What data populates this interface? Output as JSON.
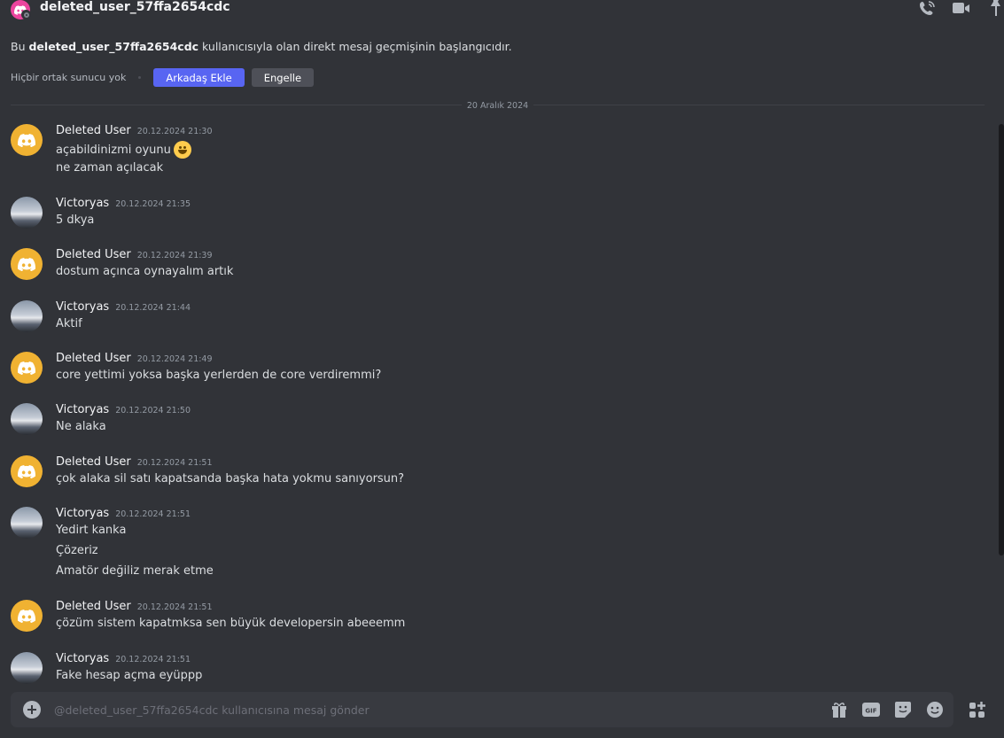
{
  "header": {
    "title": "deleted_user_57ffa2654cdc",
    "icons": [
      "phone-call-icon",
      "video-icon",
      "pin-icon"
    ]
  },
  "intro": {
    "prefix": "Bu ",
    "username": "deleted_user_57ffa2654cdc",
    "suffix": " kullanıcısıyla olan direkt mesaj geçmişinin başlangıcıdır.",
    "mutual_servers": "Hiçbir ortak sunucu yok",
    "add_friend_label": "Arkadaş Ekle",
    "block_label": "Engelle"
  },
  "date_divider": "20 Aralık 2024",
  "messages": [
    {
      "user": "Deleted User",
      "time": "20.12.2024 21:30",
      "avatar": "discord-logo-icon",
      "lines": [
        "açabildinizmi oyunu",
        "ne zaman açılacak"
      ],
      "emoji": "grinning-face-emoji"
    },
    {
      "user": "Victoryas",
      "time": "20.12.2024 21:35",
      "avatar": "user-photo",
      "lines": [
        "5 dkya"
      ]
    },
    {
      "user": "Deleted User",
      "time": "20.12.2024 21:39",
      "avatar": "discord-logo-icon",
      "lines": [
        "dostum açınca oynayalım artık"
      ]
    },
    {
      "user": "Victoryas",
      "time": "20.12.2024 21:44",
      "avatar": "user-photo",
      "lines": [
        "Aktif"
      ]
    },
    {
      "user": "Deleted User",
      "time": "20.12.2024 21:49",
      "avatar": "discord-logo-icon",
      "lines": [
        "core yettimi yoksa başka yerlerden de core verdiremmi?"
      ]
    },
    {
      "user": "Victoryas",
      "time": "20.12.2024 21:50",
      "avatar": "user-photo",
      "lines": [
        "Ne alaka"
      ]
    },
    {
      "user": "Deleted User",
      "time": "20.12.2024 21:51",
      "avatar": "discord-logo-icon",
      "lines": [
        "çok alaka sil satı kapatsanda başka hata yokmu sanıyorsun?"
      ]
    },
    {
      "user": "Victoryas",
      "time": "20.12.2024 21:51",
      "avatar": "user-photo",
      "lines": [
        "Yedirt kanka",
        "Çözeriz",
        "Amatör değiliz merak etme"
      ]
    },
    {
      "user": "Deleted User",
      "time": "20.12.2024 21:51",
      "avatar": "discord-logo-icon",
      "lines": [
        "çözüm sistem kapatmksa sen büyük developersin abeeemm"
      ]
    },
    {
      "user": "Victoryas",
      "time": "20.12.2024 21:51",
      "avatar": "user-photo",
      "lines": [
        "Fake hesap açma eyüppp"
      ]
    }
  ],
  "composer": {
    "placeholder": "@deleted_user_57ffa2654cdc kullanıcısına mesaj gönder",
    "value": "",
    "icons": [
      "gift-icon",
      "gif-icon",
      "sticker-icon",
      "emoji-icon",
      "apps-icon"
    ],
    "gif_label": "GIF"
  },
  "colors": {
    "background": "#313338",
    "accent": "#5865f2",
    "discord_avatar": "#f0b232",
    "dm_avatar": "#eb459e"
  }
}
